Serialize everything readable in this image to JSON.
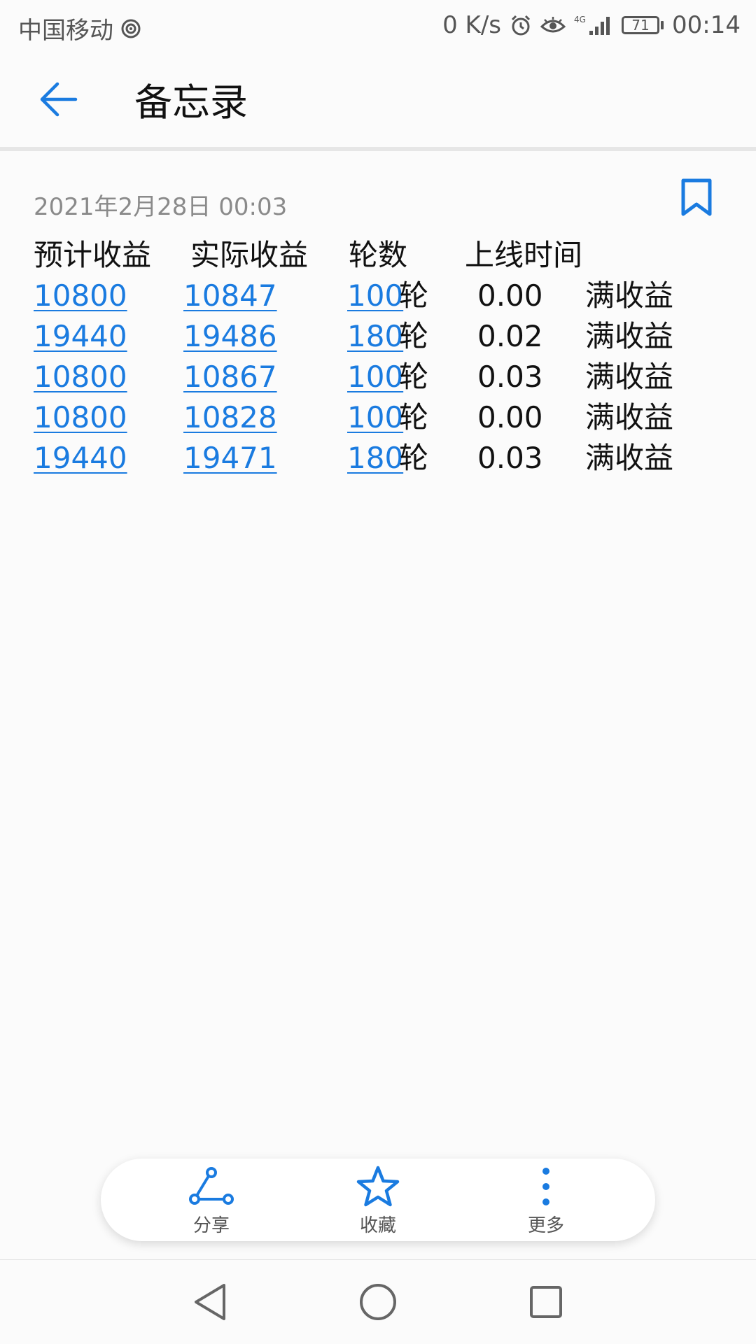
{
  "status_bar": {
    "carrier": "中国移动",
    "net_speed": "0 K/s",
    "network_type": "4G",
    "battery_level": "71",
    "time": "00:14"
  },
  "title_bar": {
    "title": "备忘录"
  },
  "note": {
    "date": "2021年2月28日 00:03",
    "headers": [
      "预计收益",
      "实际收益",
      "轮数",
      "上线时间"
    ],
    "rows": [
      {
        "expected": "10800",
        "actual": "10847",
        "rounds_num": "100",
        "rounds_unit": "轮",
        "online_time": "0.00",
        "status": "满收益"
      },
      {
        "expected": "19440",
        "actual": "19486",
        "rounds_num": "180",
        "rounds_unit": "轮",
        "online_time": "0.02",
        "status": "满收益"
      },
      {
        "expected": "10800",
        "actual": "10867",
        "rounds_num": "100",
        "rounds_unit": "轮",
        "online_time": "0.03",
        "status": "满收益"
      },
      {
        "expected": "10800",
        "actual": "10828",
        "rounds_num": "100",
        "rounds_unit": "轮",
        "online_time": "0.00",
        "status": "满收益"
      },
      {
        "expected": "19440",
        "actual": "19471",
        "rounds_num": "180",
        "rounds_unit": "轮",
        "online_time": "0.03",
        "status": "满收益"
      }
    ]
  },
  "actions": {
    "share": "分享",
    "favorite": "收藏",
    "more": "更多"
  },
  "colors": {
    "accent": "#1a7be0",
    "text": "#111111",
    "muted": "#8a8a8a"
  }
}
